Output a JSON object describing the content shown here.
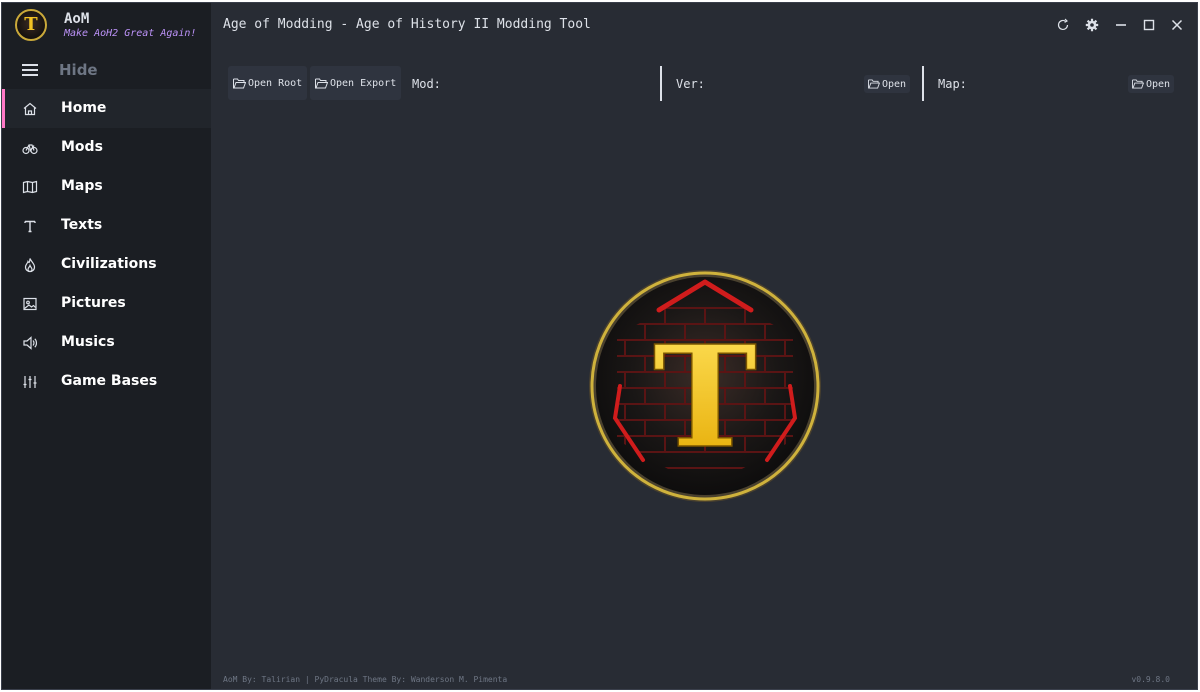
{
  "brand": {
    "logo_letter": "T",
    "name": "AoM",
    "tagline": "Make AoH2 Great Again!"
  },
  "window": {
    "title": "Age of Modding - Age of History II Modding Tool"
  },
  "sidebar": {
    "toggle_label": "Hide",
    "items": [
      {
        "label": "Home",
        "icon": "home-icon",
        "active": true
      },
      {
        "label": "Mods",
        "icon": "bicycle-icon"
      },
      {
        "label": "Maps",
        "icon": "map-icon"
      },
      {
        "label": "Texts",
        "icon": "text-icon"
      },
      {
        "label": "Civilizations",
        "icon": "flame-icon"
      },
      {
        "label": "Pictures",
        "icon": "image-icon"
      },
      {
        "label": "Musics",
        "icon": "speaker-icon"
      },
      {
        "label": "Game Bases",
        "icon": "sliders-icon"
      }
    ]
  },
  "toolbar": {
    "open_root": "Open Root",
    "open_export": "Open Export",
    "mod_label": "Mod:",
    "ver_label": "Ver:",
    "ver_open": "Open",
    "map_label": "Map:",
    "map_open": "Open"
  },
  "logo": {
    "letter": "T"
  },
  "footer": {
    "credits": "AoM By: Talirian | PyDracula Theme By: Wanderson M. Pimenta",
    "version": "v0.9.8.0"
  },
  "colors": {
    "accent": "#ff79c6",
    "tagline": "#bd93f9",
    "background": "#282c34",
    "sidebar": "#1b1e23",
    "logo_gold": "#f2c224",
    "logo_red": "#c8141e"
  }
}
